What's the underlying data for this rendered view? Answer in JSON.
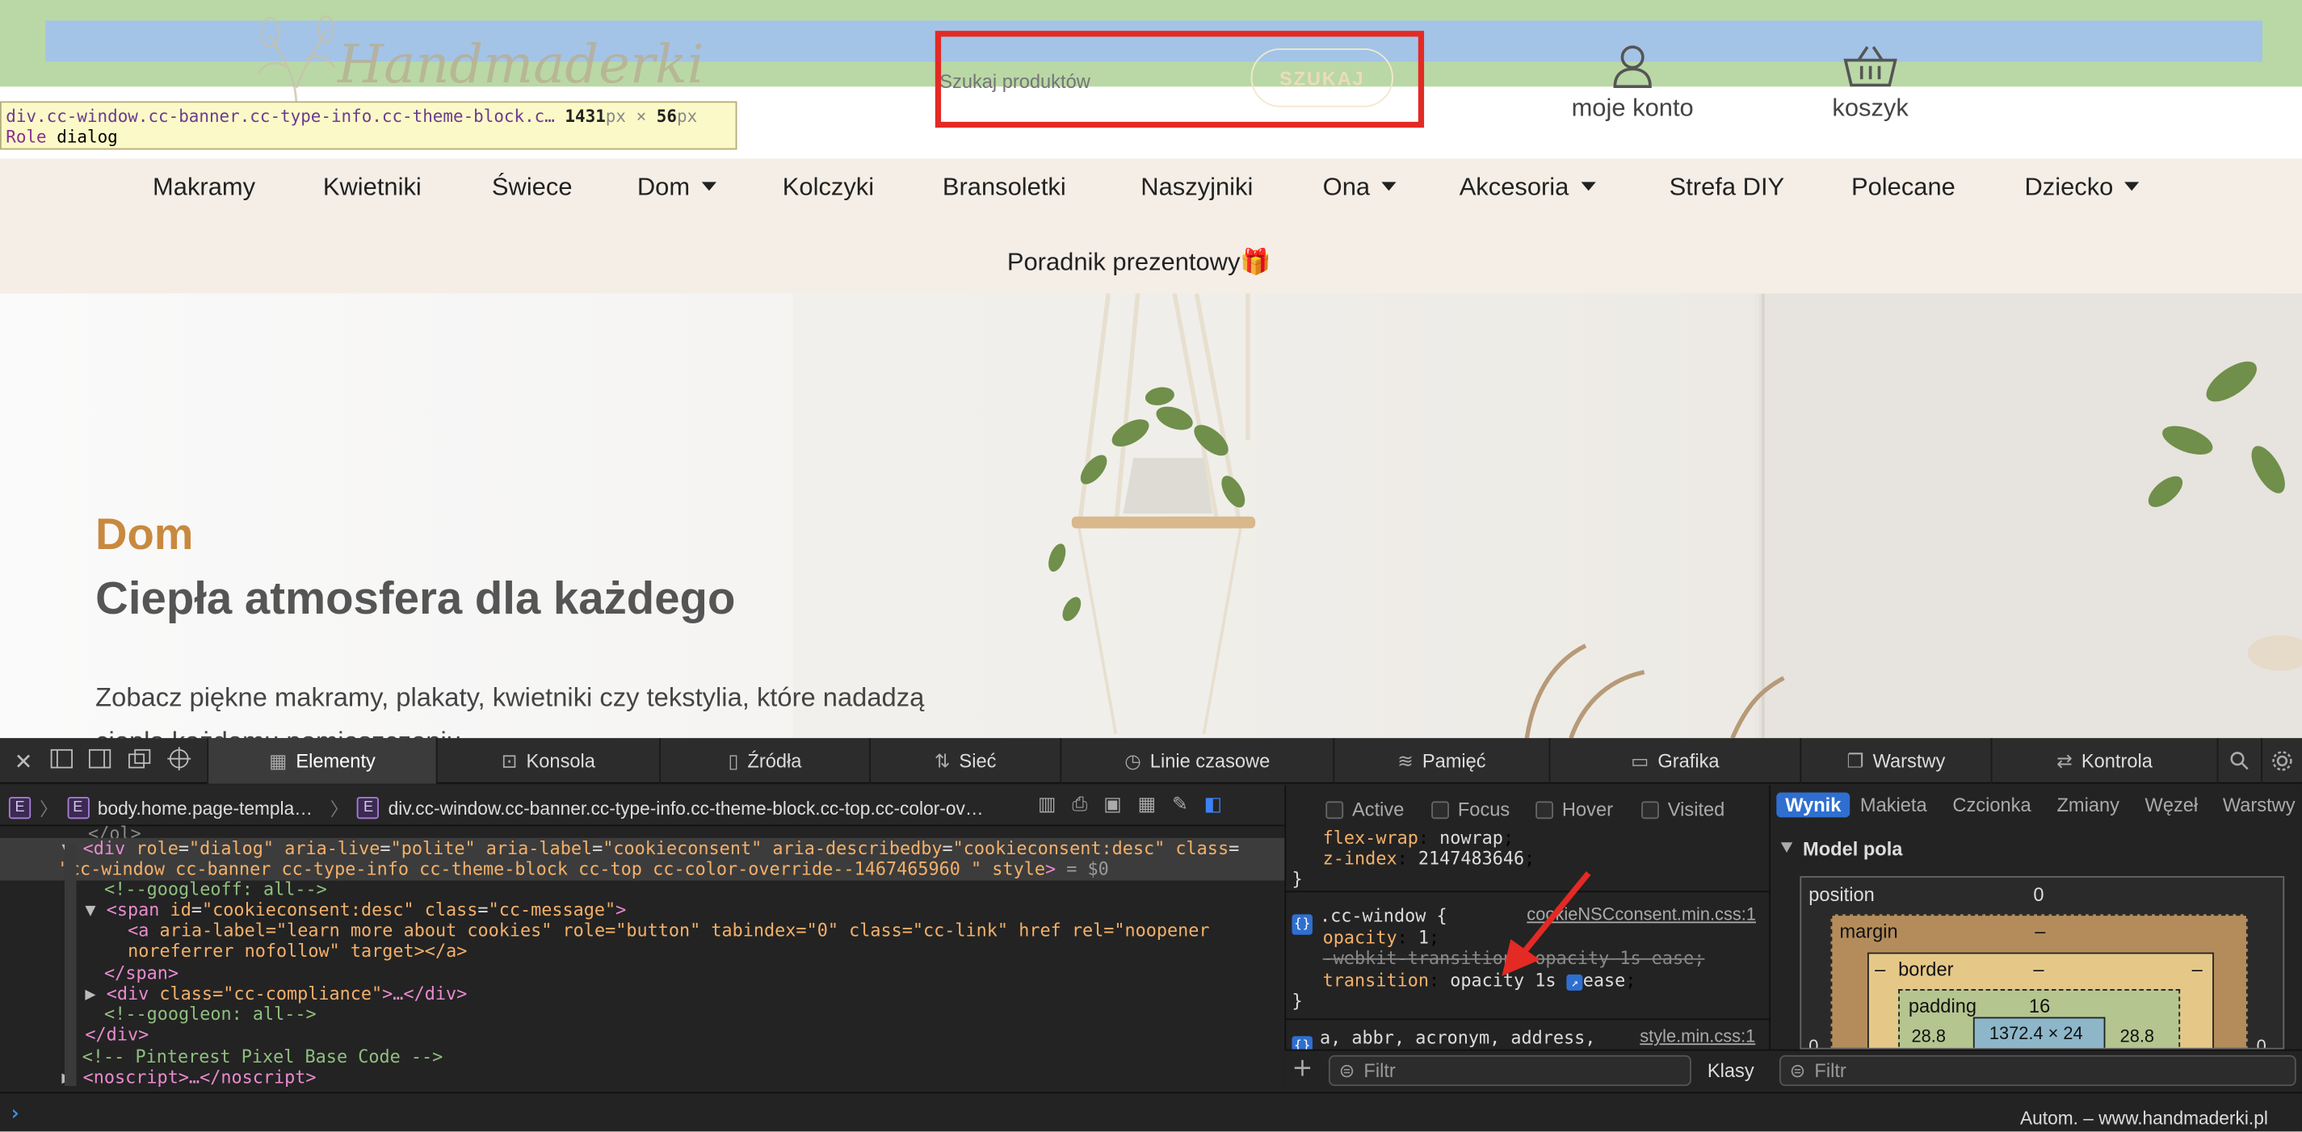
{
  "site": {
    "logo_text": "Handmaderki",
    "search": {
      "placeholder": "Szukaj produktów",
      "button_label": "SZUKAJ"
    },
    "header_links": [
      {
        "label": "moje konto",
        "icon": "user-icon"
      },
      {
        "label": "koszyk",
        "icon": "basket-icon"
      }
    ],
    "nav": [
      {
        "label": "Makramy",
        "dropdown": false
      },
      {
        "label": "Kwietniki",
        "dropdown": false
      },
      {
        "label": "Świece",
        "dropdown": false
      },
      {
        "label": "Dom",
        "dropdown": true
      },
      {
        "label": "Kolczyki",
        "dropdown": false
      },
      {
        "label": "Bransoletki",
        "dropdown": false
      },
      {
        "label": "Naszyjniki",
        "dropdown": false
      },
      {
        "label": "Ona",
        "dropdown": true
      },
      {
        "label": "Akcesoria",
        "dropdown": true
      },
      {
        "label": "Strefa DIY",
        "dropdown": false
      },
      {
        "label": "Polecane",
        "dropdown": false
      },
      {
        "label": "Dziecko",
        "dropdown": true
      }
    ],
    "nav_second_row": "Poradnik prezentowy🎁",
    "hero": {
      "eyebrow": "Dom",
      "title": "Ciepła atmosfera dla każdego",
      "desc": "Zobacz piękne makramy, plakaty, kwietniki czy tekstylia, które nadadzą ciepła każdemu pomieszczeniu."
    },
    "colors": {
      "accent": "#c8893f",
      "nav_bg": "#f4eee6",
      "highlight_outer": "#b9d8a6",
      "highlight_inner": "#a3c4e6",
      "callout_red": "#e32a24"
    }
  },
  "tooltip": {
    "selector": "div.cc-window.cc-banner.cc-type-info.cc-theme-block.c…",
    "width": "1431",
    "height": "56",
    "unit": "px",
    "times": "×",
    "role_label": "Role",
    "role_value": "dialog"
  },
  "devtools": {
    "tabs": [
      {
        "label": "Elementy",
        "icon": "elements-icon",
        "active": true
      },
      {
        "label": "Konsola",
        "icon": "console-icon"
      },
      {
        "label": "Źródła",
        "icon": "sources-icon"
      },
      {
        "label": "Sieć",
        "icon": "network-icon"
      },
      {
        "label": "Linie czasowe",
        "icon": "timeline-icon"
      },
      {
        "label": "Pamięć",
        "icon": "memory-icon"
      },
      {
        "label": "Grafika",
        "icon": "graphics-icon"
      },
      {
        "label": "Warstwy",
        "icon": "layers-icon"
      },
      {
        "label": "Kontrola",
        "icon": "audit-icon"
      }
    ],
    "breadcrumb": [
      "body.home.page-templa…",
      "div.cc-window.cc-banner.cc-type-info.cc-theme-block.cc-top.cc-color-ov…"
    ],
    "dom": {
      "line0": "</ol>",
      "selected_open": "<div",
      "selected_attrs": [
        {
          "name": "role",
          "value": "\"dialog\""
        },
        {
          "name": "aria-live",
          "value": "\"polite\""
        },
        {
          "name": "aria-label",
          "value": "\"cookieconsent\""
        },
        {
          "name": "aria-describedby",
          "value": "\"cookieconsent:desc\""
        },
        {
          "name": "class",
          "value": ""
        }
      ],
      "selected_class_value": "\"cc-window cc-banner cc-type-info cc-theme-block cc-top cc-color-override--1467465960 \"",
      "selected_style": "style",
      "selected_ref": "= $0",
      "comment_off": "<!--googleoff: all-->",
      "span_line": {
        "tag": "span",
        "id_attr": "id",
        "id_val": "\"cookieconsent:desc\"",
        "class_attr": "class",
        "class_val": "\"cc-message\""
      },
      "a_line1": {
        "attrs": "aria-label=\"learn more about cookies\" role=\"button\" tabindex=\"0\" class=\"cc-link\" href rel=\"noopener"
      },
      "a_line2": "noreferrer nofollow\" target></a>",
      "span_close": "</span>",
      "compliance": {
        "open": "<div",
        "attr": "class=\"cc-compliance\"",
        "rest": ">…</div>"
      },
      "comment_on": "<!--googleon: all-->",
      "div_close": "</div>",
      "pinterest_comment": "<!-- Pinterest Pixel Base Code -->",
      "noscript": "<noscript>…</noscript>"
    },
    "styles": {
      "pseudo": [
        "Active",
        "Focus",
        "Hover",
        "Visited"
      ],
      "prev_rule": [
        {
          "prop": "flex-wrap",
          "val": "nowrap"
        },
        {
          "prop": "z-index",
          "val": "2147483646"
        }
      ],
      "rule_selector": ".cc-window",
      "rule_source": "cookieNSCconsent.min.css:1",
      "rule_props": [
        {
          "prop": "opacity",
          "val": "1"
        },
        {
          "prop": "-webkit-transition",
          "val": "opacity 1s ease",
          "struck": true
        },
        {
          "prop": "transition",
          "val": "opacity 1s",
          "val2": "ease"
        }
      ],
      "next_selector": "a, abbr, acronym, address,",
      "next_source": "style.min.css:1",
      "filter_placeholder": "Filtr",
      "classes_label": "Klasy"
    },
    "computed": {
      "tabs": [
        "Wynik",
        "Makieta",
        "Czcionka",
        "Zmiany",
        "Węzeł",
        "Warstwy"
      ],
      "section_title": "Model pola",
      "position_label": "position",
      "position_val": "0",
      "margin_label": "margin",
      "margin_val": "–",
      "border_label": "border",
      "border_val": "–",
      "padding_label": "padding",
      "padding_val": "16",
      "content_val": "1372.4 × 24",
      "side_left": "28.8",
      "side_right": "28.8",
      "outer_left": "0",
      "outer_right": "0",
      "filter_placeholder": "Filtr"
    },
    "console_prompt": "›",
    "status_right": "Autom. – www.handmaderki.pl"
  }
}
